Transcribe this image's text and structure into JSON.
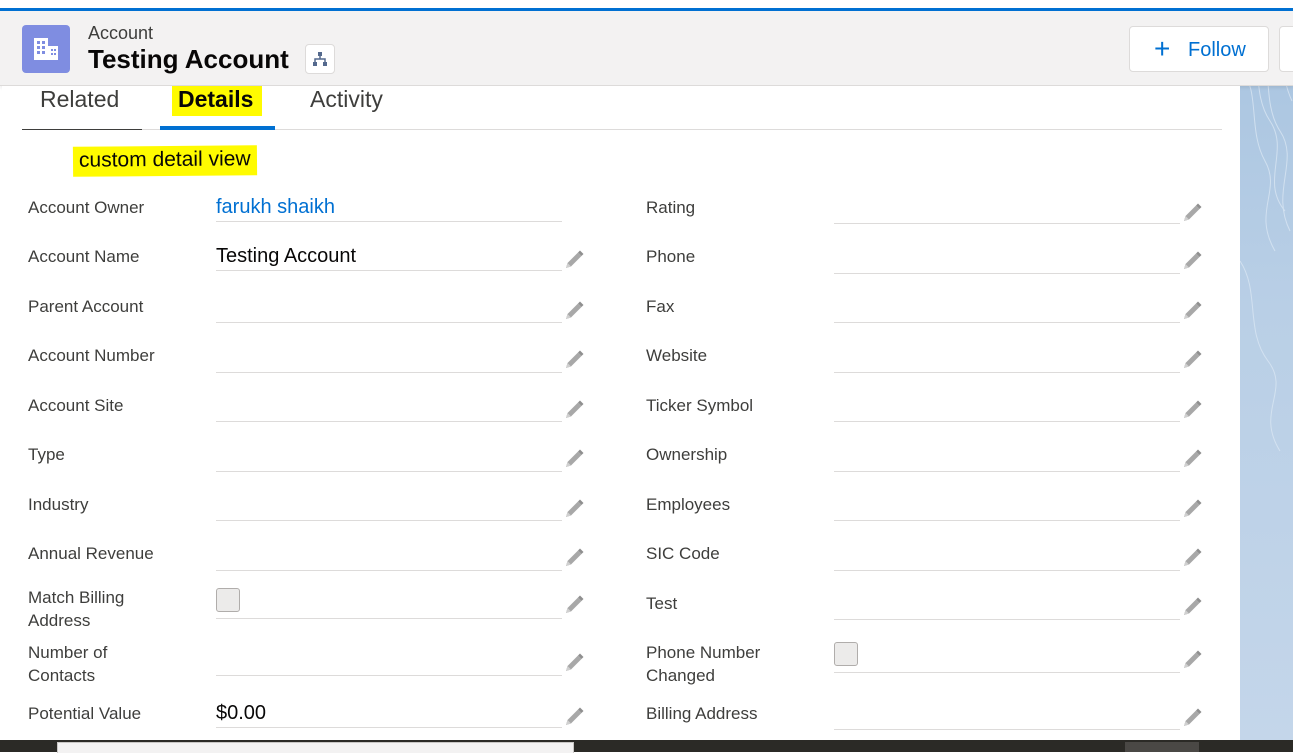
{
  "header": {
    "object_type": "Account",
    "record_name": "Testing Account",
    "follow_label": "Follow"
  },
  "tabs": [
    {
      "label": "Related"
    },
    {
      "label": "Details"
    },
    {
      "label": "Activity"
    }
  ],
  "section": {
    "custom_label": "custom detail view"
  },
  "fields_left": [
    {
      "label": "Account Owner",
      "value": "farukh shaikh"
    },
    {
      "label": "Account Name",
      "value": "Testing Account"
    },
    {
      "label": "Parent Account",
      "value": ""
    },
    {
      "label": "Account Number",
      "value": ""
    },
    {
      "label": "Account Site",
      "value": ""
    },
    {
      "label": "Type",
      "value": ""
    },
    {
      "label": "Industry",
      "value": ""
    },
    {
      "label": "Annual Revenue",
      "value": ""
    },
    {
      "label": "Match Billing Address",
      "value": ""
    },
    {
      "label": "Number of Contacts",
      "value": ""
    },
    {
      "label": "Potential Value",
      "value": "$0.00"
    }
  ],
  "fields_right": [
    {
      "label": "Rating",
      "value": ""
    },
    {
      "label": "Phone",
      "value": ""
    },
    {
      "label": "Fax",
      "value": ""
    },
    {
      "label": "Website",
      "value": ""
    },
    {
      "label": "Ticker Symbol",
      "value": ""
    },
    {
      "label": "Ownership",
      "value": ""
    },
    {
      "label": "Employees",
      "value": ""
    },
    {
      "label": "SIC Code",
      "value": ""
    },
    {
      "label": "Test",
      "value": ""
    },
    {
      "label": "Phone Number Changed",
      "value": ""
    },
    {
      "label": "Billing Address",
      "value": ""
    }
  ],
  "colors": {
    "brand": "#0070d2",
    "object_icon": "#7f8de1",
    "highlight": "#fffb00"
  },
  "icons": {
    "object_icon": "account-building-icon",
    "hierarchy": "hierarchy-icon",
    "edit": "pencil-edit-icon",
    "follow": "plus-icon"
  }
}
